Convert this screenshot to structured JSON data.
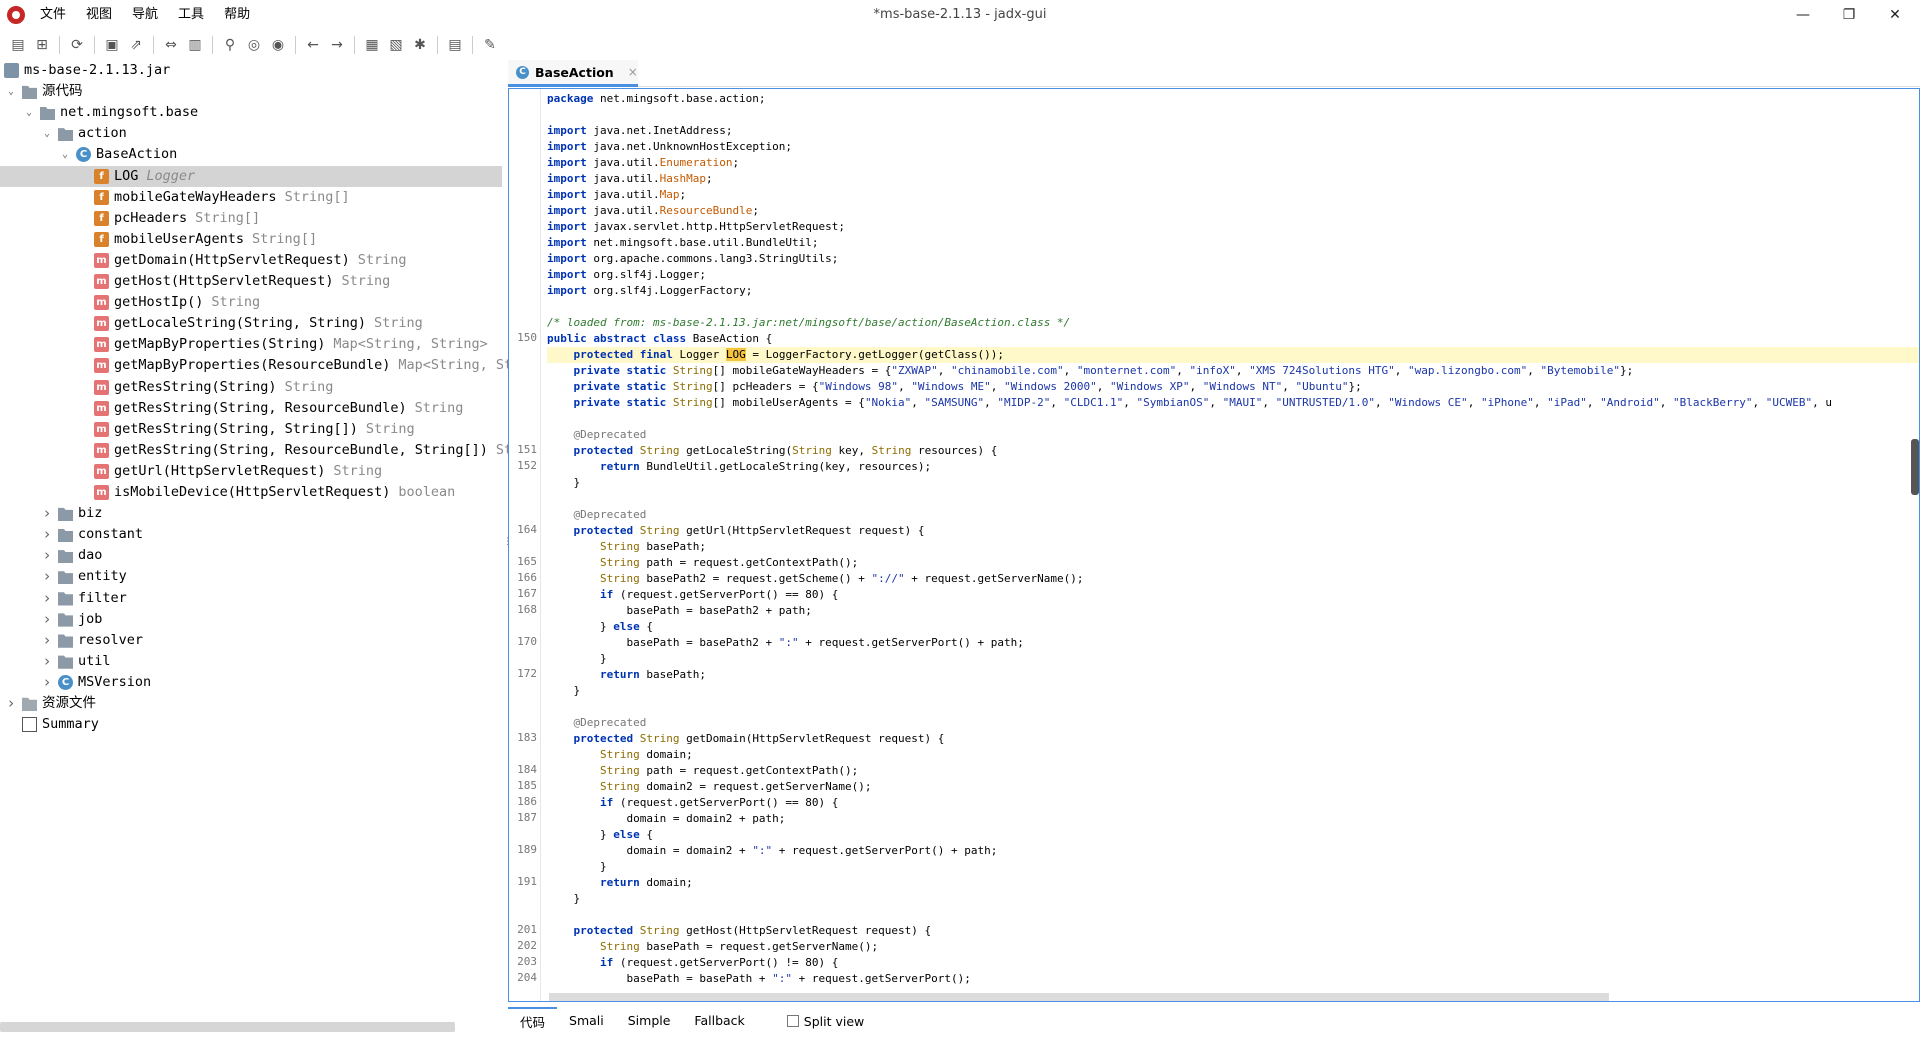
{
  "window": {
    "title": "*ms-base-2.1.13 - jadx-gui",
    "controls": {
      "minimize": "—",
      "maximize": "❐",
      "close": "✕"
    }
  },
  "menu": [
    "文件",
    "视图",
    "导航",
    "工具",
    "帮助"
  ],
  "toolbar_icons": [
    "open-icon",
    "add-files-icon",
    "sync-icon",
    "save-icon",
    "export-icon",
    "flatten-icon",
    "tree-icon",
    "search-icon",
    "find-class-icon",
    "find-usage-icon",
    "back-icon",
    "forward-icon",
    "decompile-icon",
    "bookmark-icon",
    "debug-icon",
    "log-icon",
    "settings-icon"
  ],
  "tree": {
    "root": "ms-base-2.1.13.jar",
    "source_root": "源代码",
    "package": "net.mingsoft.base",
    "action_folder": "action",
    "class_name": "BaseAction",
    "members": [
      {
        "kind": "field",
        "name": "LOG",
        "type": "Logger",
        "selected": true
      },
      {
        "kind": "field",
        "name": "mobileGateWayHeaders",
        "type": "String[]"
      },
      {
        "kind": "field",
        "name": "pcHeaders",
        "type": "String[]"
      },
      {
        "kind": "field",
        "name": "mobileUserAgents",
        "type": "String[]"
      },
      {
        "kind": "method",
        "name": "getDomain(HttpServletRequest)",
        "type": "String"
      },
      {
        "kind": "method",
        "name": "getHost(HttpServletRequest)",
        "type": "String"
      },
      {
        "kind": "method",
        "name": "getHostIp()",
        "type": "String"
      },
      {
        "kind": "method",
        "name": "getLocaleString(String, String)",
        "type": "String"
      },
      {
        "kind": "method",
        "name": "getMapByProperties(String)",
        "type": "Map<String, String>"
      },
      {
        "kind": "method",
        "name": "getMapByProperties(ResourceBundle)",
        "type": "Map<String, St"
      },
      {
        "kind": "method",
        "name": "getResString(String)",
        "type": "String"
      },
      {
        "kind": "method",
        "name": "getResString(String, ResourceBundle)",
        "type": "String"
      },
      {
        "kind": "method",
        "name": "getResString(String, String[])",
        "type": "String"
      },
      {
        "kind": "method",
        "name": "getResString(String, ResourceBundle, String[])",
        "type": "St"
      },
      {
        "kind": "method",
        "name": "getUrl(HttpServletRequest)",
        "type": "String"
      },
      {
        "kind": "method",
        "name": "isMobileDevice(HttpServletRequest)",
        "type": "boolean"
      }
    ],
    "packages": [
      "biz",
      "constant",
      "dao",
      "entity",
      "filter",
      "job",
      "resolver",
      "util"
    ],
    "ms_version": "MSVersion",
    "resources": "资源文件",
    "summary": "Summary"
  },
  "editor": {
    "tab_label": "BaseAction",
    "tab_close": "×",
    "bottom_tabs": [
      "代码",
      "Smali",
      "Simple",
      "Fallback"
    ],
    "split_view_label": "Split view",
    "gutter": [
      {
        "n": "150",
        "row": 15
      },
      {
        "n": "151",
        "row": 22
      },
      {
        "n": "152",
        "row": 23
      },
      {
        "n": "164",
        "row": 27
      },
      {
        "n": "165",
        "row": 29
      },
      {
        "n": "166",
        "row": 30
      },
      {
        "n": "167",
        "row": 31
      },
      {
        "n": "168",
        "row": 32
      },
      {
        "n": "170",
        "row": 34
      },
      {
        "n": "172",
        "row": 36
      },
      {
        "n": "183",
        "row": 40
      },
      {
        "n": "184",
        "row": 42
      },
      {
        "n": "185",
        "row": 43
      },
      {
        "n": "186",
        "row": 44
      },
      {
        "n": "187",
        "row": 45
      },
      {
        "n": "189",
        "row": 47
      },
      {
        "n": "191",
        "row": 49
      },
      {
        "n": "201",
        "row": 52
      },
      {
        "n": "202",
        "row": 53
      },
      {
        "n": "203",
        "row": 54
      },
      {
        "n": "204",
        "row": 55
      }
    ],
    "code_lines": [
      "package net.mingsoft.base.action;",
      "",
      "import java.net.InetAddress;",
      "import java.net.UnknownHostException;",
      "import java.util.Enumeration;",
      "import java.util.HashMap;",
      "import java.util.Map;",
      "import java.util.ResourceBundle;",
      "import javax.servlet.http.HttpServletRequest;",
      "import net.mingsoft.base.util.BundleUtil;",
      "import org.apache.commons.lang3.StringUtils;",
      "import org.slf4j.Logger;",
      "import org.slf4j.LoggerFactory;",
      "",
      "/* loaded from: ms-base-2.1.13.jar:net/mingsoft/base/action/BaseAction.class */",
      "public abstract class BaseAction {",
      "    protected final Logger LOG = LoggerFactory.getLogger(getClass());",
      "    private static String[] mobileGateWayHeaders = {\"ZXWAP\", \"chinamobile.com\", \"monternet.com\", \"infoX\", \"XMS 724Solutions HTG\", \"wap.lizongbo.com\", \"Bytemobile\"};",
      "    private static String[] pcHeaders = {\"Windows 98\", \"Windows ME\", \"Windows 2000\", \"Windows XP\", \"Windows NT\", \"Ubuntu\"};",
      "    private static String[] mobileUserAgents = {\"Nokia\", \"SAMSUNG\", \"MIDP-2\", \"CLDC1.1\", \"SymbianOS\", \"MAUI\", \"UNTRUSTED/1.0\", \"Windows CE\", \"iPhone\", \"iPad\", \"Android\", \"BlackBerry\", \"UCWEB\", \"u",
      "",
      "    @Deprecated",
      "    protected String getLocaleString(String key, String resources) {",
      "        return BundleUtil.getLocaleString(key, resources);",
      "    }",
      "",
      "    @Deprecated",
      "    protected String getUrl(HttpServletRequest request) {",
      "        String basePath;",
      "        String path = request.getContextPath();",
      "        String basePath2 = request.getScheme() + \"://\" + request.getServerName();",
      "        if (request.getServerPort() == 80) {",
      "            basePath = basePath2 + path;",
      "        } else {",
      "            basePath = basePath2 + \":\" + request.getServerPort() + path;",
      "        }",
      "        return basePath;",
      "    }",
      "",
      "    @Deprecated",
      "    protected String getDomain(HttpServletRequest request) {",
      "        String domain;",
      "        String path = request.getContextPath();",
      "        String domain2 = request.getServerName();",
      "        if (request.getServerPort() == 80) {",
      "            domain = domain2 + path;",
      "        } else {",
      "            domain = domain2 + \":\" + request.getServerPort() + path;",
      "        }",
      "        return domain;",
      "    }",
      "",
      "    protected String getHost(HttpServletRequest request) {",
      "        String basePath = request.getServerName();",
      "        if (request.getServerPort() != 80) {",
      "            basePath = basePath + \":\" + request.getServerPort();"
    ],
    "highlight_row": 16,
    "selected_word": "LOG"
  },
  "colors": {
    "accent": "#4a90e2",
    "keyword": "#0033b3",
    "string": "#1b36a8",
    "comment": "#2f7a2f",
    "type": "#8c6d00",
    "highlight": "#fff8c8"
  }
}
